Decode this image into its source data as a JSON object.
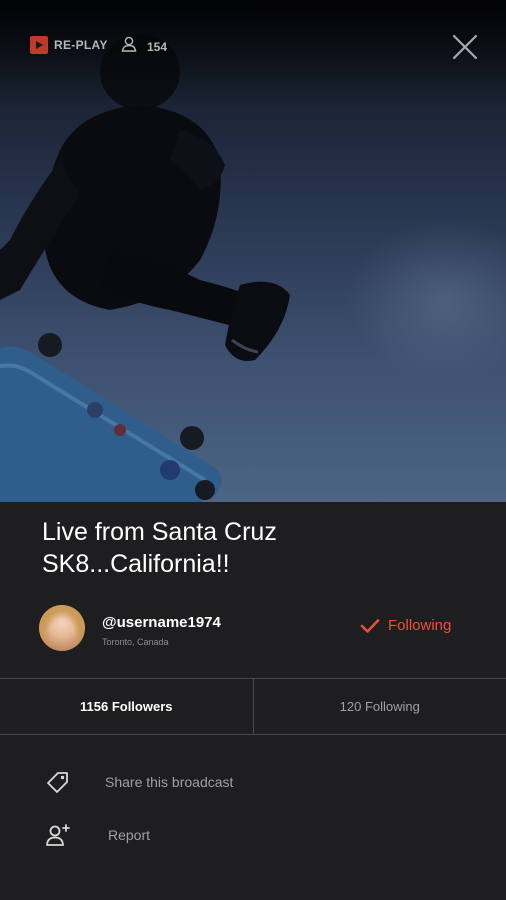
{
  "header": {
    "replay_label": "RE-PLAY",
    "viewer_count": "154"
  },
  "broadcast": {
    "title_line1": "Live from Santa Cruz",
    "title_line2": "SK8...California!!"
  },
  "user": {
    "username": "@username1974",
    "location": "Toronto, Canada",
    "follow_label": "Following"
  },
  "stats": {
    "followers": "1156 Followers",
    "following": "120 Following"
  },
  "actions": [
    {
      "label": "Share this broadcast",
      "icon": "tag-icon"
    },
    {
      "label": "Report",
      "icon": "person-add-icon"
    }
  ],
  "colors": {
    "accent": "#e8503a",
    "replay_badge": "#c0392b",
    "panel_bg": "#1e1e20"
  }
}
